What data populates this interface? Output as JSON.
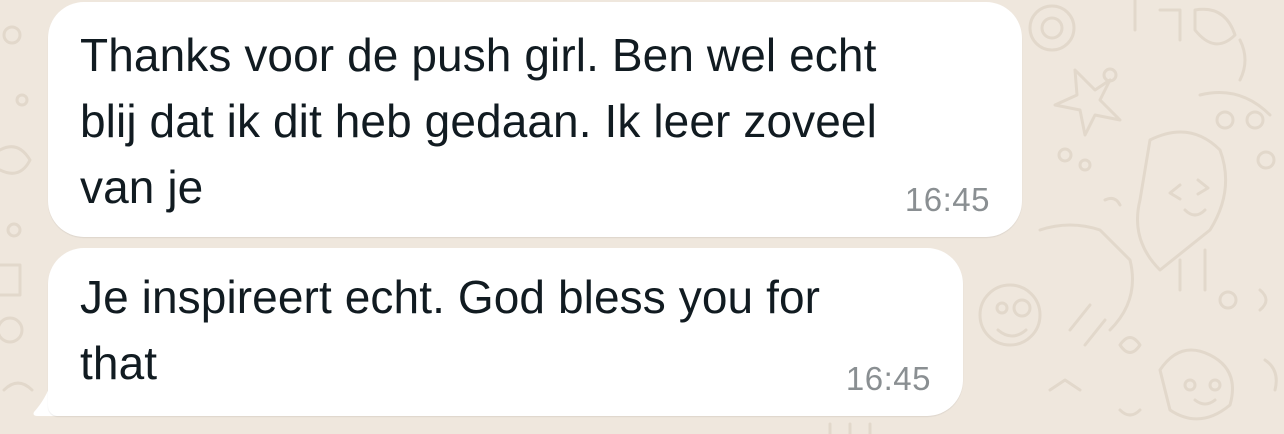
{
  "chat": {
    "background_color": "#efe7dd",
    "bubble_color": "#ffffff",
    "messages": [
      {
        "text": "Thanks voor de push girl. Ben wel echt\nblij dat ik dit heb gedaan. Ik leer zoveel\nvan je",
        "time": "16:45",
        "direction": "incoming"
      },
      {
        "text": "Je inspireert echt. God bless you for\nthat",
        "time": "16:45",
        "direction": "incoming"
      }
    ]
  }
}
